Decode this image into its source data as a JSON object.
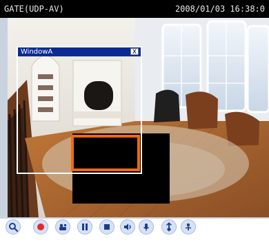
{
  "header": {
    "stream_label": "GATE(UDP-AV)",
    "datetime": "2008/01/03 16:38:0"
  },
  "overlay_window": {
    "title": "WindowA",
    "close_label": "X"
  },
  "toolbar": {
    "buttons": [
      {
        "name": "zoom-icon"
      },
      {
        "name": "record-icon"
      },
      {
        "name": "snapshot-icon"
      },
      {
        "name": "pause-icon"
      },
      {
        "name": "stop-icon"
      },
      {
        "name": "speaker-icon"
      },
      {
        "name": "mic-icon"
      },
      {
        "name": "digital-output-icon"
      },
      {
        "name": "pan-tilt-icon"
      }
    ]
  },
  "colors": {
    "motion_box": "#ee6a10",
    "window_title_bar": "#0b2a93",
    "toolbar_button": "#d6e2f7",
    "header_bg": "#000000"
  }
}
